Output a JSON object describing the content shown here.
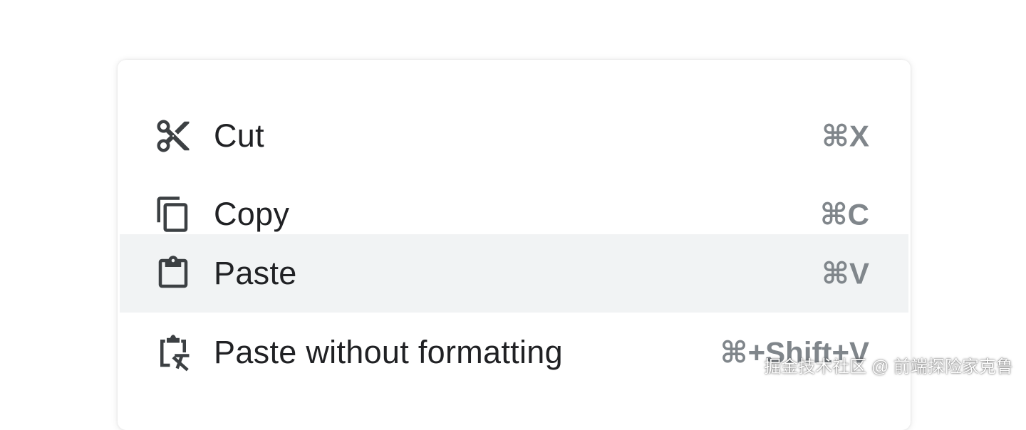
{
  "context_menu": {
    "items": [
      {
        "label": "Cut",
        "shortcut": "⌘X",
        "icon": "scissors-icon",
        "highlighted": false
      },
      {
        "label": "Copy",
        "shortcut": "⌘C",
        "icon": "copy-icon",
        "highlighted": false
      },
      {
        "label": "Paste",
        "shortcut": "⌘V",
        "icon": "clipboard-icon",
        "highlighted": true
      },
      {
        "label": "Paste without formatting",
        "shortcut": "⌘+Shift+V",
        "icon": "clipboard-clear-format-icon",
        "highlighted": false
      }
    ]
  },
  "watermark": "掘金技术社区 @ 前端探险家克鲁",
  "colors": {
    "text": "#202124",
    "shortcut": "#80868b",
    "icon": "#3c4043",
    "highlight": "#f1f3f4"
  }
}
